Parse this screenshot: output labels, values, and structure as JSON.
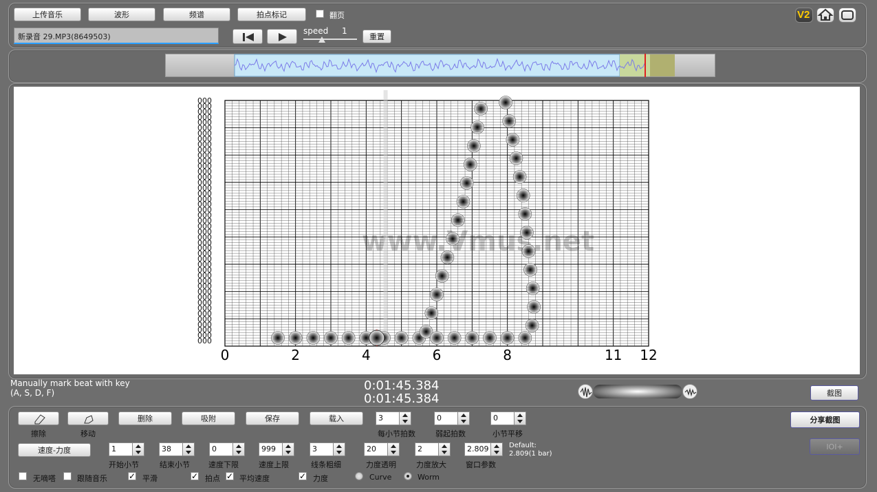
{
  "toolbar": {
    "upload_label": "上传音乐",
    "waveform_label": "波形",
    "spectrum_label": "频谱",
    "beatmark_label": "拍点标记",
    "flip_label": "翻页",
    "flip_checked": false,
    "logo_label": "V2"
  },
  "file": {
    "name": "新录音 29.MP3(8649503)"
  },
  "playback": {
    "speed_label": "speed",
    "speed_value": "1",
    "reset_label": "重置"
  },
  "chart_data": {
    "type": "scatter",
    "x_ticks": [
      "0",
      "2",
      "4",
      "6",
      "8",
      "11",
      "12"
    ],
    "xlim": [
      0,
      12
    ],
    "grid": true,
    "watermark": "www.Vmus.net",
    "series": [
      {
        "values": [
          [
            1.5,
            0
          ],
          [
            2,
            0
          ],
          [
            2.5,
            0
          ],
          [
            3,
            0
          ],
          [
            3.5,
            0
          ],
          [
            4,
            0
          ],
          [
            4.5,
            0
          ],
          [
            5,
            0
          ],
          [
            5.5,
            0
          ],
          [
            5.7,
            0.5
          ],
          [
            5.85,
            2
          ],
          [
            6,
            3.5
          ],
          [
            6.15,
            5
          ],
          [
            6.3,
            6.5
          ],
          [
            6.45,
            8
          ],
          [
            6.6,
            9.5
          ],
          [
            6.75,
            11
          ],
          [
            6.85,
            12.5
          ],
          [
            6.95,
            14
          ],
          [
            7.05,
            15.5
          ],
          [
            7.15,
            17
          ],
          [
            7.25,
            18.5
          ]
        ]
      },
      {
        "values": [
          [
            6,
            0
          ],
          [
            6.5,
            0
          ],
          [
            7,
            0
          ],
          [
            7.5,
            0
          ],
          [
            8,
            0
          ],
          [
            8.5,
            0
          ],
          [
            8.7,
            1
          ],
          [
            8.75,
            2.5
          ],
          [
            8.72,
            4
          ],
          [
            8.65,
            5.5
          ],
          [
            8.6,
            7
          ],
          [
            8.55,
            8.5
          ],
          [
            8.5,
            10
          ],
          [
            8.45,
            11.5
          ],
          [
            8.35,
            13
          ],
          [
            8.25,
            14.5
          ],
          [
            8.15,
            16
          ],
          [
            8.05,
            17.5
          ],
          [
            7.95,
            19
          ]
        ]
      }
    ],
    "current_marker": 4.3
  },
  "status": {
    "hint_line1": "Manually mark beat with key",
    "hint_line2": "(A, S, D, F)",
    "time1": "0:01:45.384",
    "time2": "0:01:45.384",
    "screenshot_label": "截图"
  },
  "controls": {
    "erase_label": "擦除",
    "move_label": "移动",
    "delete_label": "删除",
    "snap_label": "吸附",
    "save_label": "保存",
    "load_label": "载入",
    "beats_per_bar_value": "3",
    "beats_per_bar_label": "每小节拍数",
    "pickup_value": "0",
    "pickup_label": "弱起拍数",
    "bar_shift_value": "0",
    "bar_shift_label": "小节平移",
    "share_label": "分享截图",
    "ioi_label": "IOI+",
    "tempo_dynamics_label": "速度-力度",
    "start_bar_value": "1",
    "start_bar_label": "开始小节",
    "end_bar_value": "38",
    "end_bar_label": "结束小节",
    "tempo_min_value": "0",
    "tempo_min_label": "速度下限",
    "tempo_max_value": "999",
    "tempo_max_label": "速度上限",
    "line_width_value": "3",
    "line_width_label": "线条粗细",
    "dyn_opacity_value": "20",
    "dyn_opacity_label": "力度透明",
    "dyn_zoom_value": "2",
    "dyn_zoom_label": "力度放大",
    "window_value": "2.809",
    "window_label": "窗口参数",
    "default_line1": "Default:",
    "default_line2": "2.809(1 bar)",
    "no_metronome_label": "无嘀嗒",
    "follow_music_label": "跟随音乐",
    "smooth_label": "平滑",
    "beats_label": "拍点",
    "avg_tempo_label": "平均速度",
    "dynamics_label": "力度",
    "curve_label": "Curve",
    "worm_label": "Worm",
    "no_metronome_checked": false,
    "follow_music_checked": false,
    "smooth_checked": true,
    "beats_checked": true,
    "avg_tempo_checked": true,
    "dynamics_checked": true,
    "mode_selected": "Worm"
  }
}
